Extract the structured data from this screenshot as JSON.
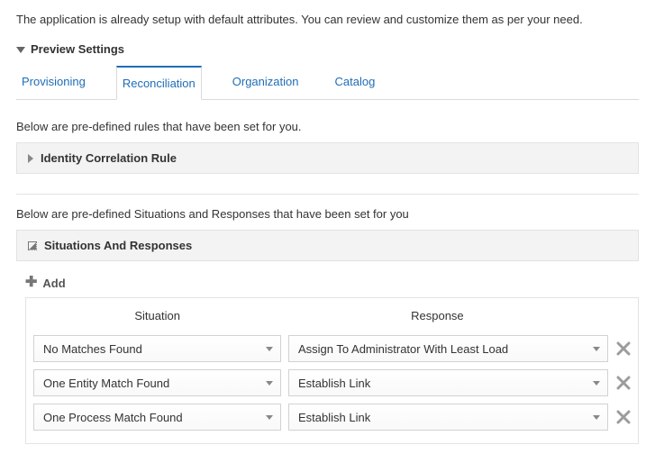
{
  "intro": "The application is already setup with default attributes. You can review and customize them as per your need.",
  "preview_settings_label": "Preview Settings",
  "tabs": {
    "provisioning": "Provisioning",
    "reconciliation": "Reconciliation",
    "organization": "Organization",
    "catalog": "Catalog"
  },
  "rules_desc": "Below are pre-defined rules that have been set for you.",
  "identity_rule_label": "Identity Correlation Rule",
  "situations_desc": "Below are pre-defined Situations and Responses that have been set for you",
  "situations_panel_label": "Situations And Responses",
  "add_label": "Add",
  "table": {
    "header_situation": "Situation",
    "header_response": "Response",
    "rows": [
      {
        "situation": "No Matches Found",
        "response": "Assign To Administrator With Least Load"
      },
      {
        "situation": "One Entity Match Found",
        "response": "Establish Link"
      },
      {
        "situation": "One Process Match Found",
        "response": "Establish Link"
      }
    ]
  }
}
